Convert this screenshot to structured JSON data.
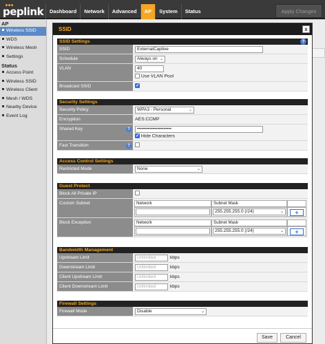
{
  "brand": "peplink",
  "nav": [
    "Dashboard",
    "Network",
    "Advanced",
    "AP",
    "System",
    "Status"
  ],
  "nav_active": "AP",
  "apply_label": "Apply Changes",
  "sidebar": {
    "ap_heading": "AP",
    "ap_items": [
      "Wireless SSID",
      "WDS",
      "Wireless Mesh",
      "Settings"
    ],
    "status_heading": "Status",
    "status_items": [
      "Access Point",
      "Wireless SSID",
      "Wireless Client",
      "Mesh / WDS",
      "Nearby Device",
      "Event Log"
    ]
  },
  "modal": {
    "title": "SSID",
    "close": "x",
    "ssid_settings": {
      "title": "SSID Settings",
      "ssid_label": "SSID",
      "ssid_value": "ExternalCaptive",
      "schedule_label": "Schedule",
      "schedule_value": "Always on",
      "vlan_label": "VLAN",
      "vlan_value": "40",
      "vlan_pool_label": "Use VLAN Pool",
      "broadcast_label": "Broadcast SSID"
    },
    "security": {
      "title": "Security Settings",
      "policy_label": "Security Policy",
      "policy_value": "WPA3 - Personal",
      "encryption_label": "Encryption",
      "encryption_value": "AES:CCMP",
      "key_label": "Shared Key",
      "key_value": "••••••••••••••••••••••",
      "hide_label": "Hide Characters",
      "fast_label": "Fast Transition"
    },
    "access": {
      "title": "Access Control Settings",
      "mode_label": "Restricted Mode",
      "mode_value": "None"
    },
    "guest": {
      "title": "Guest Protect",
      "block_private_label": "Block All Private IP",
      "subnet_label": "Custom Subnet",
      "exception_label": "Block Exception",
      "network_header": "Network",
      "mask_header": "Subnet Mask",
      "mask_value": "255.255.255.0 (/24)",
      "add": "+"
    },
    "bandwidth": {
      "title": "Bandwidth Management",
      "rows": [
        {
          "label": "Upstream Limit",
          "placeholder": "Unlimited",
          "unit": "kbps"
        },
        {
          "label": "Downstream Limit",
          "placeholder": "Unlimited",
          "unit": "kbps"
        },
        {
          "label": "Client Upstream Limit",
          "placeholder": "Unlimited",
          "unit": "kbps"
        },
        {
          "label": "Client Downstream Limit",
          "placeholder": "Unlimited",
          "unit": "kbps"
        }
      ]
    },
    "firewall": {
      "title": "Firewall Settings",
      "mode_label": "Firewall Mode",
      "mode_value": "Disable"
    },
    "save": "Save",
    "cancel": "Cancel"
  },
  "help_glyph": "?",
  "colors": {
    "accent": "#f5a623",
    "header": "#1c1c1c",
    "selected": "#5a8bc7",
    "link": "#2f6fdc"
  }
}
